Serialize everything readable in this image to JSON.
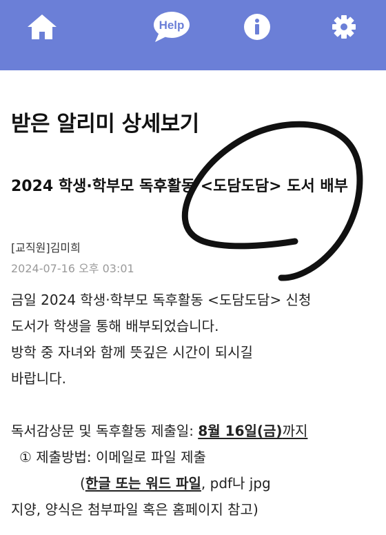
{
  "nav": {
    "home_icon": "home-icon",
    "help_label": "Help",
    "info_icon": "info-icon",
    "settings_icon": "gear-icon",
    "bar_color": "#6b7fd7"
  },
  "page": {
    "title": "받은 알리미 상세보기"
  },
  "post": {
    "title": "2024 학생·학부모 독후활동 <도담도담> 도서 배부",
    "author": "[교직원]김미희",
    "date": "2024-07-16 오후 03:01",
    "body": {
      "line1": "금일 2024 학생·학부모 독후활동 <도담도담> 신청",
      "line2": "도서가 학생을 통해 배부되었습니다.",
      "line3": "방학 중 자녀와 함께 뜻깊은 시간이 되시길",
      "line4": "바랍니다.",
      "deadline_prefix": "독서감상문 및 독후활동 제출일: ",
      "deadline_date": "8월 16일(금)",
      "deadline_suffix": "까지",
      "method": "① 제출방법: 이메일로 파일 제출",
      "file_open": "(",
      "file_types": "한글 또는 워드 파일",
      "file_rest": ", pdf나 jpg",
      "format_note": "지양, 양식은 첨부파일 혹은 홈페이지 참고)"
    }
  }
}
